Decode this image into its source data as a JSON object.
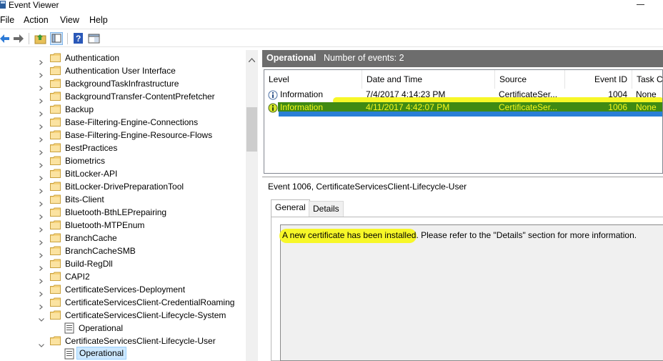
{
  "window": {
    "title": "Event Viewer"
  },
  "menu": {
    "file": "File",
    "action": "Action",
    "view": "View",
    "help": "Help"
  },
  "toolbar": {
    "icons": [
      "back-arrow-icon",
      "forward-arrow-icon",
      "folder-up-icon",
      "show-hide-pane-icon",
      "help-icon",
      "properties-pane-icon"
    ]
  },
  "tree": {
    "items": [
      {
        "label": "Authentication",
        "type": "folder",
        "expanded": false
      },
      {
        "label": "Authentication User Interface",
        "type": "folder",
        "expanded": false
      },
      {
        "label": "BackgroundTaskInfrastructure",
        "type": "folder",
        "expanded": false
      },
      {
        "label": "BackgroundTransfer-ContentPrefetcher",
        "type": "folder",
        "expanded": false
      },
      {
        "label": "Backup",
        "type": "folder",
        "expanded": false
      },
      {
        "label": "Base-Filtering-Engine-Connections",
        "type": "folder",
        "expanded": false
      },
      {
        "label": "Base-Filtering-Engine-Resource-Flows",
        "type": "folder",
        "expanded": false
      },
      {
        "label": "BestPractices",
        "type": "folder",
        "expanded": false
      },
      {
        "label": "Biometrics",
        "type": "folder",
        "expanded": false
      },
      {
        "label": "BitLocker-API",
        "type": "folder",
        "expanded": false
      },
      {
        "label": "BitLocker-DrivePreparationTool",
        "type": "folder",
        "expanded": false
      },
      {
        "label": "Bits-Client",
        "type": "folder",
        "expanded": false
      },
      {
        "label": "Bluetooth-BthLEPrepairing",
        "type": "folder",
        "expanded": false
      },
      {
        "label": "Bluetooth-MTPEnum",
        "type": "folder",
        "expanded": false
      },
      {
        "label": "BranchCache",
        "type": "folder",
        "expanded": false
      },
      {
        "label": "BranchCacheSMB",
        "type": "folder",
        "expanded": false
      },
      {
        "label": "Build-RegDll",
        "type": "folder",
        "expanded": false
      },
      {
        "label": "CAPI2",
        "type": "folder",
        "expanded": false
      },
      {
        "label": "CertificateServices-Deployment",
        "type": "folder",
        "expanded": false
      },
      {
        "label": "CertificateServicesClient-CredentialRoaming",
        "type": "folder",
        "expanded": false
      },
      {
        "label": "CertificateServicesClient-Lifecycle-System",
        "type": "folder",
        "expanded": true
      },
      {
        "label": "Operational",
        "type": "log",
        "selected": false
      },
      {
        "label": "CertificateServicesClient-Lifecycle-User",
        "type": "folder",
        "expanded": true
      },
      {
        "label": "Operational",
        "type": "log",
        "selected": true
      }
    ]
  },
  "events_panel": {
    "log_name": "Operational",
    "count_text": "Number of events: 2",
    "columns": [
      "Level",
      "Date and Time",
      "Source",
      "Event ID",
      "Task Ca"
    ],
    "rows": [
      {
        "level": "Information",
        "datetime": "7/4/2017 4:14:23 PM",
        "source": "CertificateSer...",
        "event_id": "1004",
        "task": "None",
        "selected": false
      },
      {
        "level": "Information",
        "datetime": "4/11/2017 4:42:07 PM",
        "source": "CertificateSer...",
        "event_id": "1006",
        "task": "None",
        "selected": true
      }
    ]
  },
  "detail": {
    "title": "Event 1006, CertificateServicesClient-Lifecycle-User",
    "tabs": [
      "General",
      "Details"
    ],
    "active_tab": "General",
    "description_highlighted": "A new certificate has been installed",
    "description_rest": ". Please refer to the \"Details\" section for more information."
  },
  "colors": {
    "panel_header": "#6d6d6d",
    "highlight_yellow": "#f7f71c",
    "highlight_green": "#3f8a13",
    "highlight_blue": "#2a7fd6",
    "selection": "#cce8ff"
  }
}
